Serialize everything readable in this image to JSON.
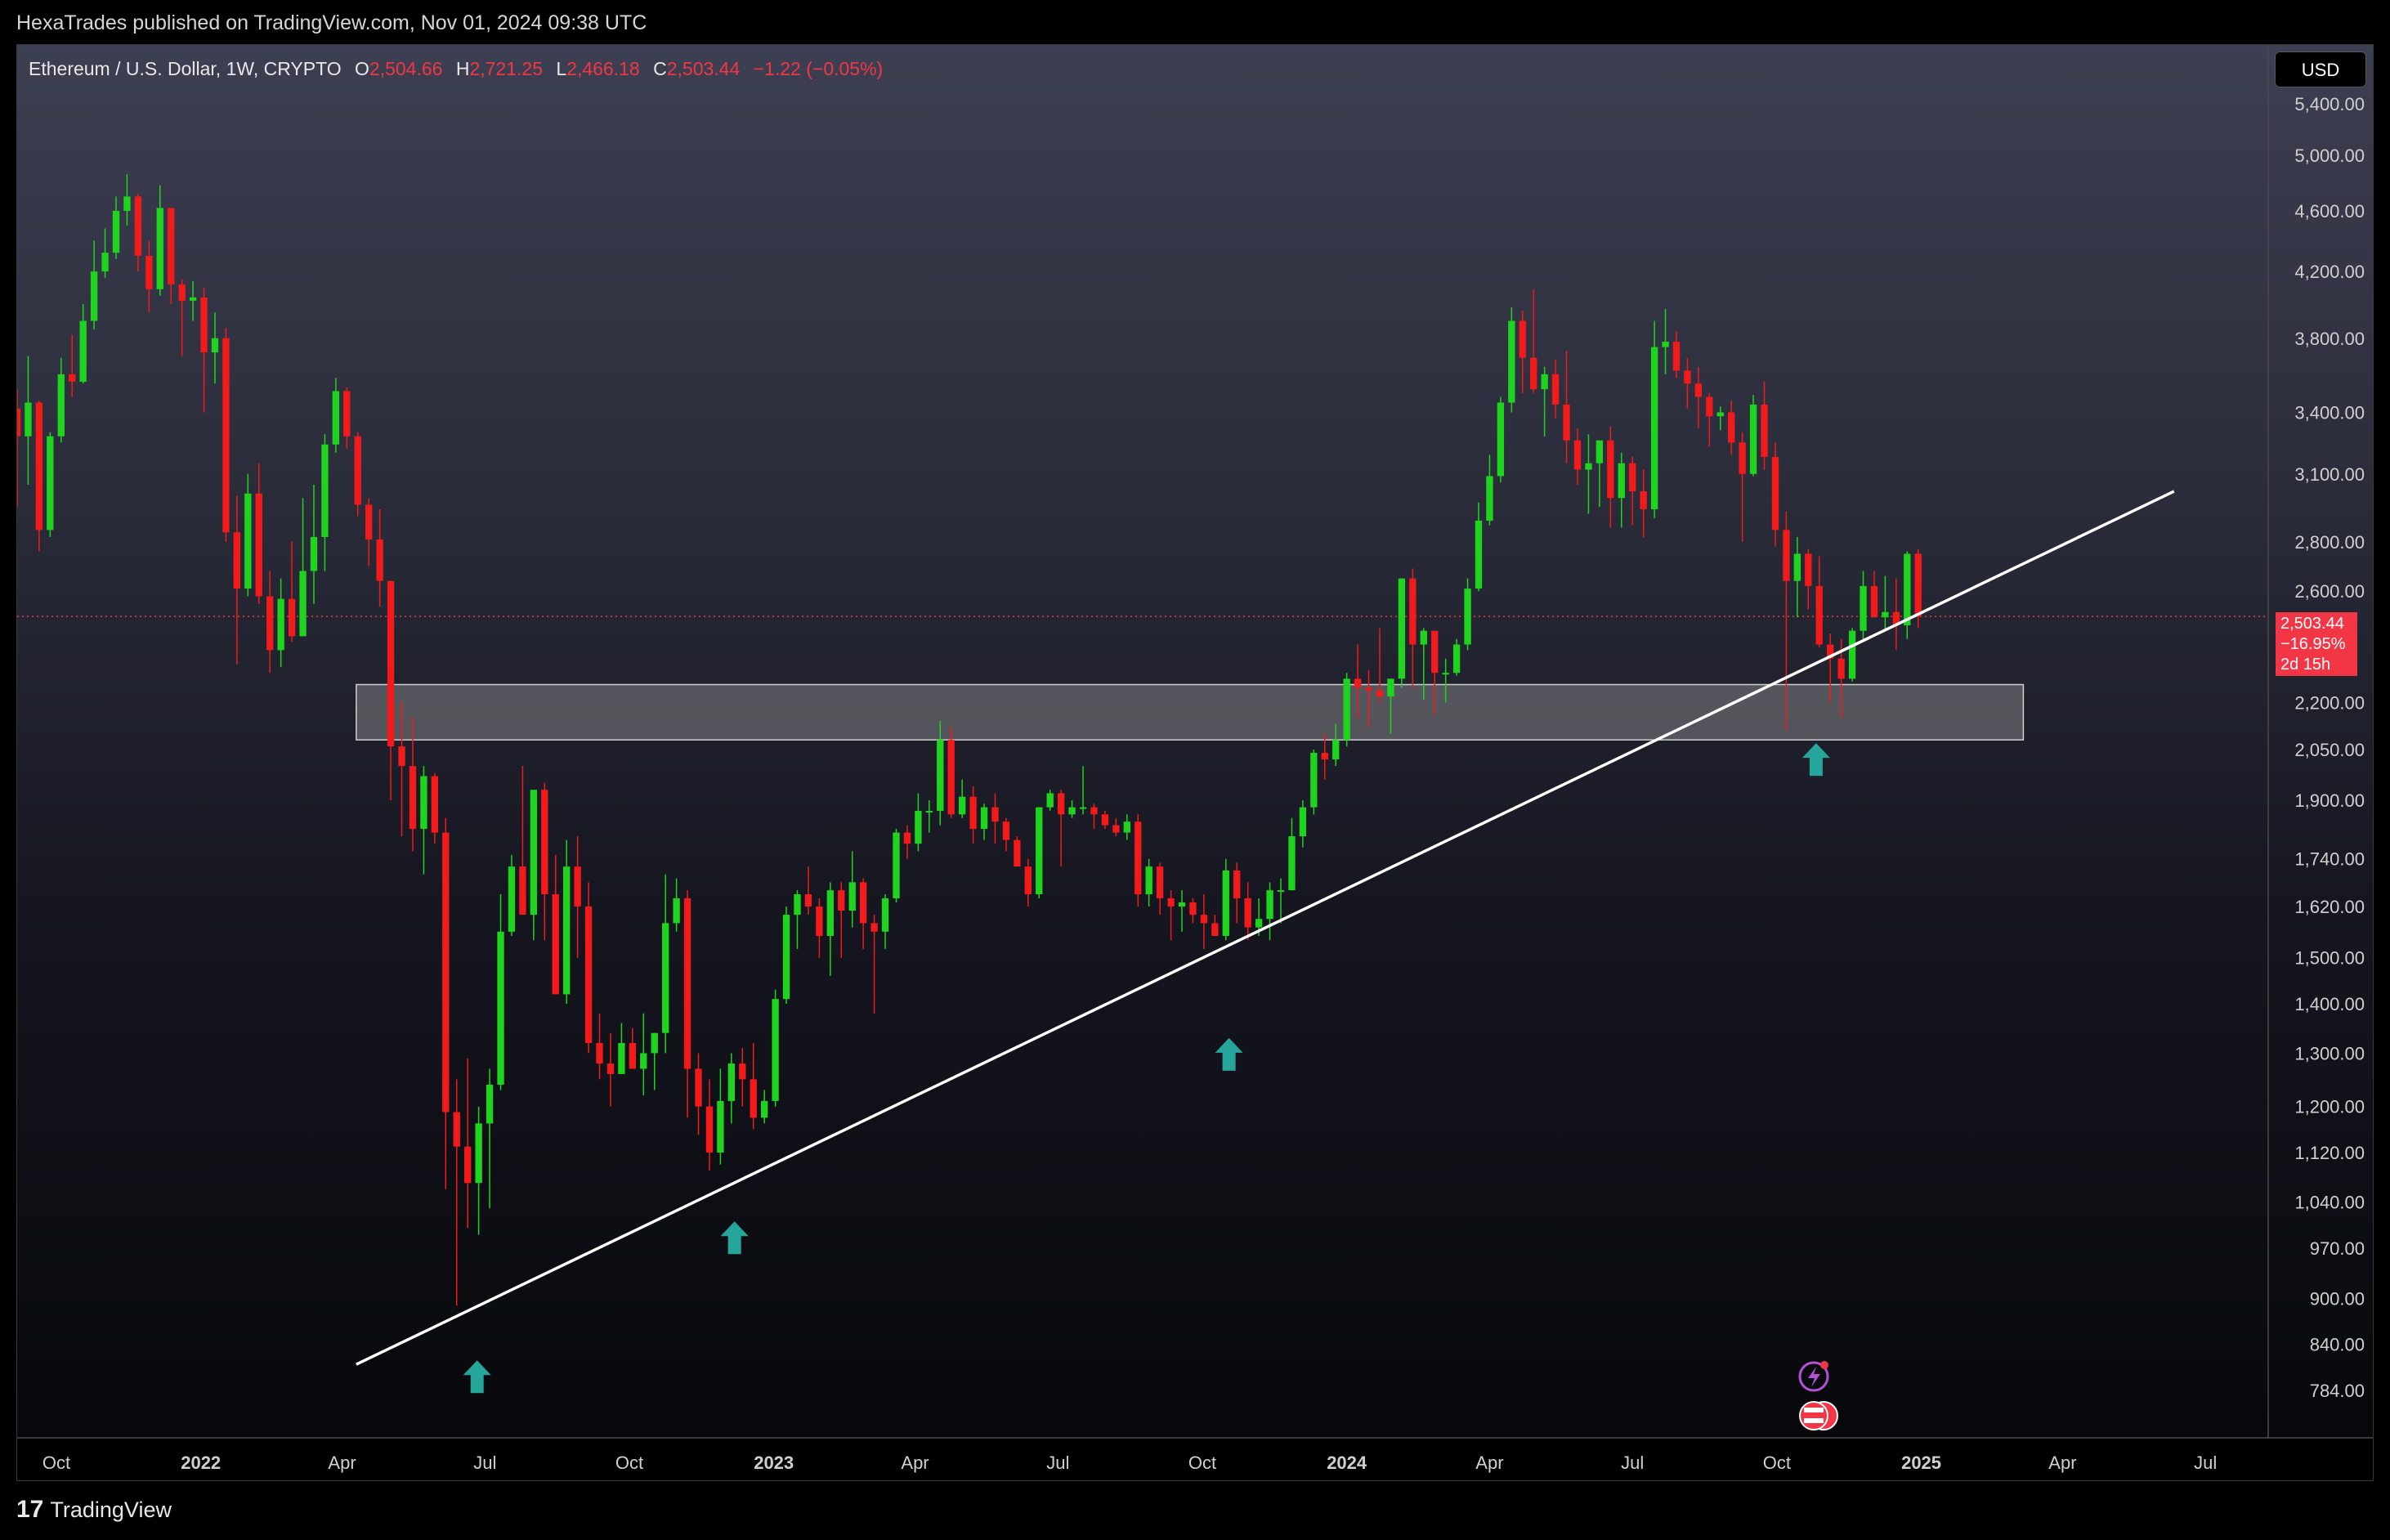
{
  "header": {
    "publisher_text": "HexaTrades published on TradingView.com, Nov 01, 2024 09:38 UTC"
  },
  "symbol": {
    "name": "Ethereum / U.S. Dollar, 1W, CRYPTO",
    "open_label": "O",
    "open": "2,504.66",
    "high_label": "H",
    "high": "2,721.25",
    "low_label": "L",
    "low": "2,466.18",
    "close_label": "C",
    "close": "2,503.44",
    "change": "−1.22 (−0.05%)"
  },
  "currency_button": "USD",
  "last_price": {
    "price": "2,503.44",
    "change_pct": "−16.95%",
    "countdown": "2d 15h"
  },
  "footer": {
    "brand": "TradingView",
    "logo_mark": "17"
  },
  "colors": {
    "up": "#1fd41f",
    "down": "#f21a1a",
    "support_zone": "#8a8a8a",
    "trendline": "#ffffff",
    "arrow": "#26a69a",
    "last_price": "#f23645"
  },
  "chart_data": {
    "type": "candlestick",
    "symbol": "Ethereum / U.S. Dollar",
    "interval": "1W",
    "y_scale": "log",
    "y_range": [
      730,
      5900
    ],
    "x_range": [
      "2021-09-06",
      "2025-08-10"
    ],
    "y_ticks": [
      5400,
      5000,
      4600,
      4200,
      3800,
      3400,
      3100,
      2800,
      2600,
      2200,
      2050,
      1900,
      1740,
      1620,
      1500,
      1400,
      1300,
      1200,
      1120,
      1040,
      970,
      900,
      840,
      784
    ],
    "y_tick_labels": [
      "5,400.00",
      "5,000.00",
      "4,600.00",
      "4,200.00",
      "3,800.00",
      "3,400.00",
      "3,100.00",
      "2,800.00",
      "2,600.00",
      "2,200.00",
      "2,050.00",
      "1,900.00",
      "1,740.00",
      "1,620.00",
      "1,500.00",
      "1,400.00",
      "1,300.00",
      "1,200.00",
      "1,120.00",
      "1,040.00",
      "970.00",
      "900.00",
      "840.00",
      "784.00"
    ],
    "x_ticks": [
      {
        "label": "Oct",
        "date": "2021-10-01",
        "bold": false
      },
      {
        "label": "2022",
        "date": "2022-01-01",
        "bold": true
      },
      {
        "label": "Apr",
        "date": "2022-04-01",
        "bold": false
      },
      {
        "label": "Jul",
        "date": "2022-07-01",
        "bold": false
      },
      {
        "label": "Oct",
        "date": "2022-10-01",
        "bold": false
      },
      {
        "label": "2023",
        "date": "2023-01-01",
        "bold": true
      },
      {
        "label": "Apr",
        "date": "2023-04-01",
        "bold": false
      },
      {
        "label": "Jul",
        "date": "2023-07-01",
        "bold": false
      },
      {
        "label": "Oct",
        "date": "2023-10-01",
        "bold": false
      },
      {
        "label": "2024",
        "date": "2024-01-01",
        "bold": true
      },
      {
        "label": "Apr",
        "date": "2024-04-01",
        "bold": false
      },
      {
        "label": "Jul",
        "date": "2024-07-01",
        "bold": false
      },
      {
        "label": "Oct",
        "date": "2024-10-01",
        "bold": false
      },
      {
        "label": "2025",
        "date": "2025-01-01",
        "bold": true
      },
      {
        "label": "Apr",
        "date": "2025-04-01",
        "bold": false
      },
      {
        "label": "Jul",
        "date": "2025-07-01",
        "bold": false
      }
    ],
    "first_week": "2021-09-06",
    "candles": [
      [
        3420,
        3520,
        2950,
        3280
      ],
      [
        3280,
        3700,
        3050,
        3450
      ],
      [
        3450,
        3460,
        2760,
        2850
      ],
      [
        2850,
        3300,
        2820,
        3280
      ],
      [
        3280,
        3690,
        3250,
        3600
      ],
      [
        3600,
        3820,
        3480,
        3560
      ],
      [
        3560,
        4000,
        3550,
        3900
      ],
      [
        3900,
        4400,
        3850,
        4200
      ],
      [
        4200,
        4480,
        4160,
        4320
      ],
      [
        4320,
        4700,
        4280,
        4600
      ],
      [
        4600,
        4860,
        4500,
        4700
      ],
      [
        4700,
        4720,
        4200,
        4300
      ],
      [
        4300,
        4400,
        3950,
        4090
      ],
      [
        4090,
        4780,
        4050,
        4620
      ],
      [
        4620,
        4620,
        4000,
        4120
      ],
      [
        4120,
        4150,
        3700,
        4020
      ],
      [
        4020,
        4140,
        3900,
        4040
      ],
      [
        4040,
        4100,
        3400,
        3720
      ],
      [
        3720,
        3950,
        3550,
        3800
      ],
      [
        3800,
        3860,
        2800,
        2840
      ],
      [
        2840,
        3000,
        2330,
        2610
      ],
      [
        2610,
        3100,
        2580,
        3010
      ],
      [
        3010,
        3150,
        2550,
        2580
      ],
      [
        2580,
        2680,
        2300,
        2380
      ],
      [
        2380,
        2650,
        2320,
        2570
      ],
      [
        2570,
        2800,
        2410,
        2430
      ],
      [
        2430,
        2990,
        2430,
        2680
      ],
      [
        2680,
        3050,
        2550,
        2820
      ],
      [
        2820,
        3290,
        2680,
        3240
      ],
      [
        3240,
        3580,
        3200,
        3510
      ],
      [
        3510,
        3530,
        3220,
        3280
      ],
      [
        3280,
        3300,
        2910,
        2960
      ],
      [
        2960,
        2990,
        2700,
        2810
      ],
      [
        2810,
        2940,
        2540,
        2640
      ],
      [
        2640,
        2640,
        1900,
        2060
      ],
      [
        2060,
        2200,
        1800,
        2000
      ],
      [
        2000,
        2150,
        1760,
        1820
      ],
      [
        1820,
        2000,
        1700,
        1970
      ],
      [
        1970,
        1980,
        1780,
        1810
      ],
      [
        1810,
        1850,
        1060,
        1190
      ],
      [
        1190,
        1250,
        890,
        1130
      ],
      [
        1130,
        1290,
        1000,
        1070
      ],
      [
        1070,
        1200,
        990,
        1170
      ],
      [
        1170,
        1270,
        1030,
        1240
      ],
      [
        1240,
        1650,
        1230,
        1560
      ],
      [
        1560,
        1750,
        1550,
        1720
      ],
      [
        1720,
        2000,
        1700,
        1600
      ],
      [
        1600,
        1920,
        1540,
        1930
      ],
      [
        1930,
        1950,
        1540,
        1650
      ],
      [
        1650,
        1750,
        1440,
        1420
      ],
      [
        1420,
        1790,
        1400,
        1720
      ],
      [
        1720,
        1800,
        1500,
        1620
      ],
      [
        1620,
        1680,
        1300,
        1320
      ],
      [
        1320,
        1380,
        1250,
        1280
      ],
      [
        1280,
        1340,
        1200,
        1260
      ],
      [
        1260,
        1360,
        1260,
        1320
      ],
      [
        1320,
        1350,
        1270,
        1270
      ],
      [
        1270,
        1380,
        1220,
        1300
      ],
      [
        1300,
        1340,
        1230,
        1340
      ],
      [
        1340,
        1700,
        1300,
        1580
      ],
      [
        1580,
        1690,
        1560,
        1640
      ],
      [
        1640,
        1660,
        1180,
        1270
      ],
      [
        1270,
        1300,
        1150,
        1200
      ],
      [
        1200,
        1250,
        1090,
        1120
      ],
      [
        1120,
        1270,
        1100,
        1210
      ],
      [
        1210,
        1300,
        1170,
        1280
      ],
      [
        1280,
        1310,
        1200,
        1250
      ],
      [
        1250,
        1320,
        1160,
        1180
      ],
      [
        1180,
        1230,
        1170,
        1210
      ],
      [
        1210,
        1430,
        1200,
        1410
      ],
      [
        1410,
        1620,
        1400,
        1600
      ],
      [
        1600,
        1660,
        1520,
        1650
      ],
      [
        1650,
        1720,
        1600,
        1620
      ],
      [
        1620,
        1640,
        1500,
        1550
      ],
      [
        1550,
        1680,
        1460,
        1660
      ],
      [
        1660,
        1680,
        1500,
        1610
      ],
      [
        1610,
        1760,
        1570,
        1680
      ],
      [
        1680,
        1690,
        1520,
        1580
      ],
      [
        1580,
        1600,
        1380,
        1560
      ],
      [
        1560,
        1650,
        1520,
        1640
      ],
      [
        1640,
        1820,
        1630,
        1810
      ],
      [
        1810,
        1830,
        1740,
        1780
      ],
      [
        1780,
        1920,
        1760,
        1870
      ],
      [
        1870,
        1900,
        1810,
        1870
      ],
      [
        1870,
        2140,
        1830,
        2080
      ],
      [
        2080,
        2120,
        1850,
        1860
      ],
      [
        1860,
        1960,
        1850,
        1910
      ],
      [
        1910,
        1940,
        1780,
        1820
      ],
      [
        1820,
        1890,
        1790,
        1880
      ],
      [
        1880,
        1920,
        1780,
        1840
      ],
      [
        1840,
        1850,
        1760,
        1790
      ],
      [
        1790,
        1800,
        1750,
        1720
      ],
      [
        1720,
        1740,
        1620,
        1650
      ],
      [
        1650,
        1880,
        1640,
        1880
      ],
      [
        1880,
        1930,
        1870,
        1920
      ],
      [
        1920,
        1930,
        1720,
        1860
      ],
      [
        1860,
        1900,
        1850,
        1880
      ],
      [
        1880,
        2000,
        1860,
        1880
      ],
      [
        1880,
        1890,
        1820,
        1860
      ],
      [
        1860,
        1870,
        1820,
        1830
      ],
      [
        1830,
        1850,
        1800,
        1810
      ],
      [
        1810,
        1860,
        1790,
        1840
      ],
      [
        1840,
        1860,
        1620,
        1650
      ],
      [
        1650,
        1740,
        1620,
        1720
      ],
      [
        1720,
        1730,
        1600,
        1640
      ],
      [
        1640,
        1660,
        1540,
        1620
      ],
      [
        1620,
        1660,
        1560,
        1630
      ],
      [
        1630,
        1640,
        1580,
        1600
      ],
      [
        1600,
        1650,
        1520,
        1580
      ],
      [
        1580,
        1600,
        1560,
        1550
      ],
      [
        1550,
        1740,
        1540,
        1710
      ],
      [
        1710,
        1730,
        1580,
        1640
      ],
      [
        1640,
        1680,
        1540,
        1570
      ],
      [
        1570,
        1640,
        1550,
        1590
      ],
      [
        1590,
        1680,
        1540,
        1660
      ],
      [
        1660,
        1690,
        1580,
        1660
      ],
      [
        1660,
        1850,
        1660,
        1800
      ],
      [
        1800,
        1900,
        1770,
        1880
      ],
      [
        1880,
        2050,
        1860,
        2040
      ],
      [
        2040,
        2100,
        1960,
        2020
      ],
      [
        2020,
        2130,
        2000,
        2080
      ],
      [
        2080,
        2300,
        2060,
        2280
      ],
      [
        2280,
        2400,
        2150,
        2250
      ],
      [
        2250,
        2310,
        2120,
        2240
      ],
      [
        2240,
        2460,
        2200,
        2220
      ],
      [
        2220,
        2260,
        2100,
        2280
      ],
      [
        2280,
        2650,
        2250,
        2650
      ],
      [
        2650,
        2690,
        2250,
        2400
      ],
      [
        2400,
        2460,
        2210,
        2450
      ],
      [
        2450,
        2450,
        2160,
        2300
      ],
      [
        2300,
        2350,
        2200,
        2300
      ],
      [
        2300,
        2420,
        2290,
        2400
      ],
      [
        2400,
        2650,
        2380,
        2610
      ],
      [
        2610,
        2970,
        2600,
        2890
      ],
      [
        2890,
        3190,
        2870,
        3090
      ],
      [
        3090,
        3480,
        3060,
        3450
      ],
      [
        3450,
        3980,
        3400,
        3900
      ],
      [
        3900,
        3960,
        3500,
        3690
      ],
      [
        3690,
        4090,
        3500,
        3520
      ],
      [
        3520,
        3640,
        3280,
        3600
      ],
      [
        3600,
        3680,
        3370,
        3440
      ],
      [
        3440,
        3730,
        3150,
        3260
      ],
      [
        3260,
        3320,
        3050,
        3120
      ],
      [
        3120,
        3290,
        2920,
        3150
      ],
      [
        3150,
        3200,
        2950,
        3260
      ],
      [
        3260,
        3330,
        2860,
        2990
      ],
      [
        2990,
        3200,
        2860,
        3150
      ],
      [
        3150,
        3180,
        2870,
        3020
      ],
      [
        3020,
        3120,
        2820,
        2940
      ],
      [
        2940,
        3900,
        2900,
        3750
      ],
      [
        3750,
        3970,
        3600,
        3780
      ],
      [
        3780,
        3840,
        3580,
        3620
      ],
      [
        3620,
        3690,
        3420,
        3550
      ],
      [
        3550,
        3640,
        3320,
        3480
      ],
      [
        3480,
        3500,
        3230,
        3380
      ],
      [
        3380,
        3430,
        3310,
        3400
      ],
      [
        3400,
        3460,
        3190,
        3250
      ],
      [
        3250,
        3300,
        2800,
        3100
      ],
      [
        3100,
        3490,
        3090,
        3440
      ],
      [
        3440,
        3560,
        3120,
        3180
      ],
      [
        3180,
        3250,
        2780,
        2850
      ],
      [
        2850,
        2930,
        2110,
        2640
      ],
      [
        2640,
        2820,
        2500,
        2750
      ],
      [
        2750,
        2770,
        2530,
        2620
      ],
      [
        2620,
        2740,
        2390,
        2400
      ],
      [
        2400,
        2440,
        2200,
        2350
      ],
      [
        2350,
        2420,
        2150,
        2280
      ],
      [
        2280,
        2460,
        2270,
        2450
      ],
      [
        2450,
        2680,
        2410,
        2620
      ],
      [
        2620,
        2680,
        2500,
        2500
      ],
      [
        2500,
        2660,
        2450,
        2520
      ],
      [
        2520,
        2650,
        2380,
        2470
      ],
      [
        2470,
        2760,
        2420,
        2750
      ],
      [
        2750,
        2770,
        2460,
        2503
      ]
    ],
    "support_zone": {
      "date_from": "2022-04-10",
      "date_to": "2025-03-07",
      "price_low": 2080,
      "price_high": 2260
    },
    "trendline": [
      {
        "date": "2022-04-10",
        "price": 815
      },
      {
        "date": "2025-06-11",
        "price": 3020
      }
    ],
    "markers": [
      {
        "type": "up-arrow",
        "date": "2022-06-26",
        "price": 820
      },
      {
        "type": "up-arrow",
        "date": "2022-12-07",
        "price": 1010
      },
      {
        "type": "up-arrow",
        "date": "2023-10-18",
        "price": 1330
      },
      {
        "type": "up-arrow",
        "date": "2024-10-26",
        "price": 2070
      }
    ],
    "last_price_line": 2503.44
  }
}
